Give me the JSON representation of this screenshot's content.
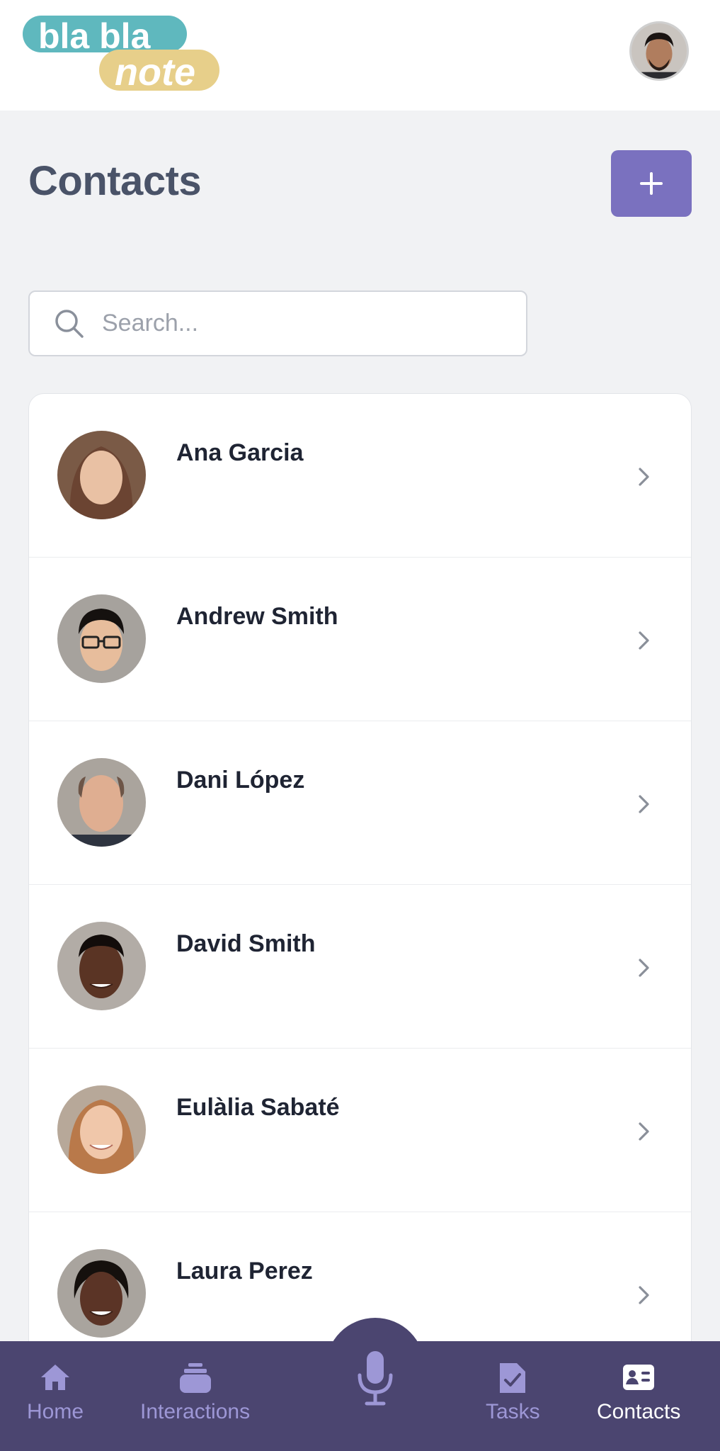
{
  "app": {
    "logo_line1": "bla bla",
    "logo_line2": "note",
    "logo_colors": {
      "teal": "#5fb8be",
      "yellow": "#e7cf8a"
    }
  },
  "page": {
    "title": "Contacts",
    "add_icon": "plus-icon",
    "accent_color": "#7a71bf"
  },
  "search": {
    "placeholder": "Search...",
    "value": "",
    "icon": "search-icon"
  },
  "contacts": [
    {
      "name": "Ana Garcia",
      "avatar_icon": "avatar",
      "chevron": "chevron-right-icon"
    },
    {
      "name": "Andrew Smith",
      "avatar_icon": "avatar",
      "chevron": "chevron-right-icon"
    },
    {
      "name": "Dani López",
      "avatar_icon": "avatar",
      "chevron": "chevron-right-icon"
    },
    {
      "name": "David Smith",
      "avatar_icon": "avatar",
      "chevron": "chevron-right-icon"
    },
    {
      "name": "Eulàlia Sabaté",
      "avatar_icon": "avatar",
      "chevron": "chevron-right-icon"
    },
    {
      "name": "Laura Perez",
      "avatar_icon": "avatar",
      "chevron": "chevron-right-icon"
    }
  ],
  "nav": {
    "background": "#4b4570",
    "items": [
      {
        "label": "Home",
        "icon": "home-icon",
        "active": false
      },
      {
        "label": "Interactions",
        "icon": "stack-icon",
        "active": false
      },
      {
        "label": "Tasks",
        "icon": "task-check-icon",
        "active": false
      },
      {
        "label": "Contacts",
        "icon": "contact-card-icon",
        "active": true
      }
    ],
    "center_icon": "microphone-icon"
  }
}
